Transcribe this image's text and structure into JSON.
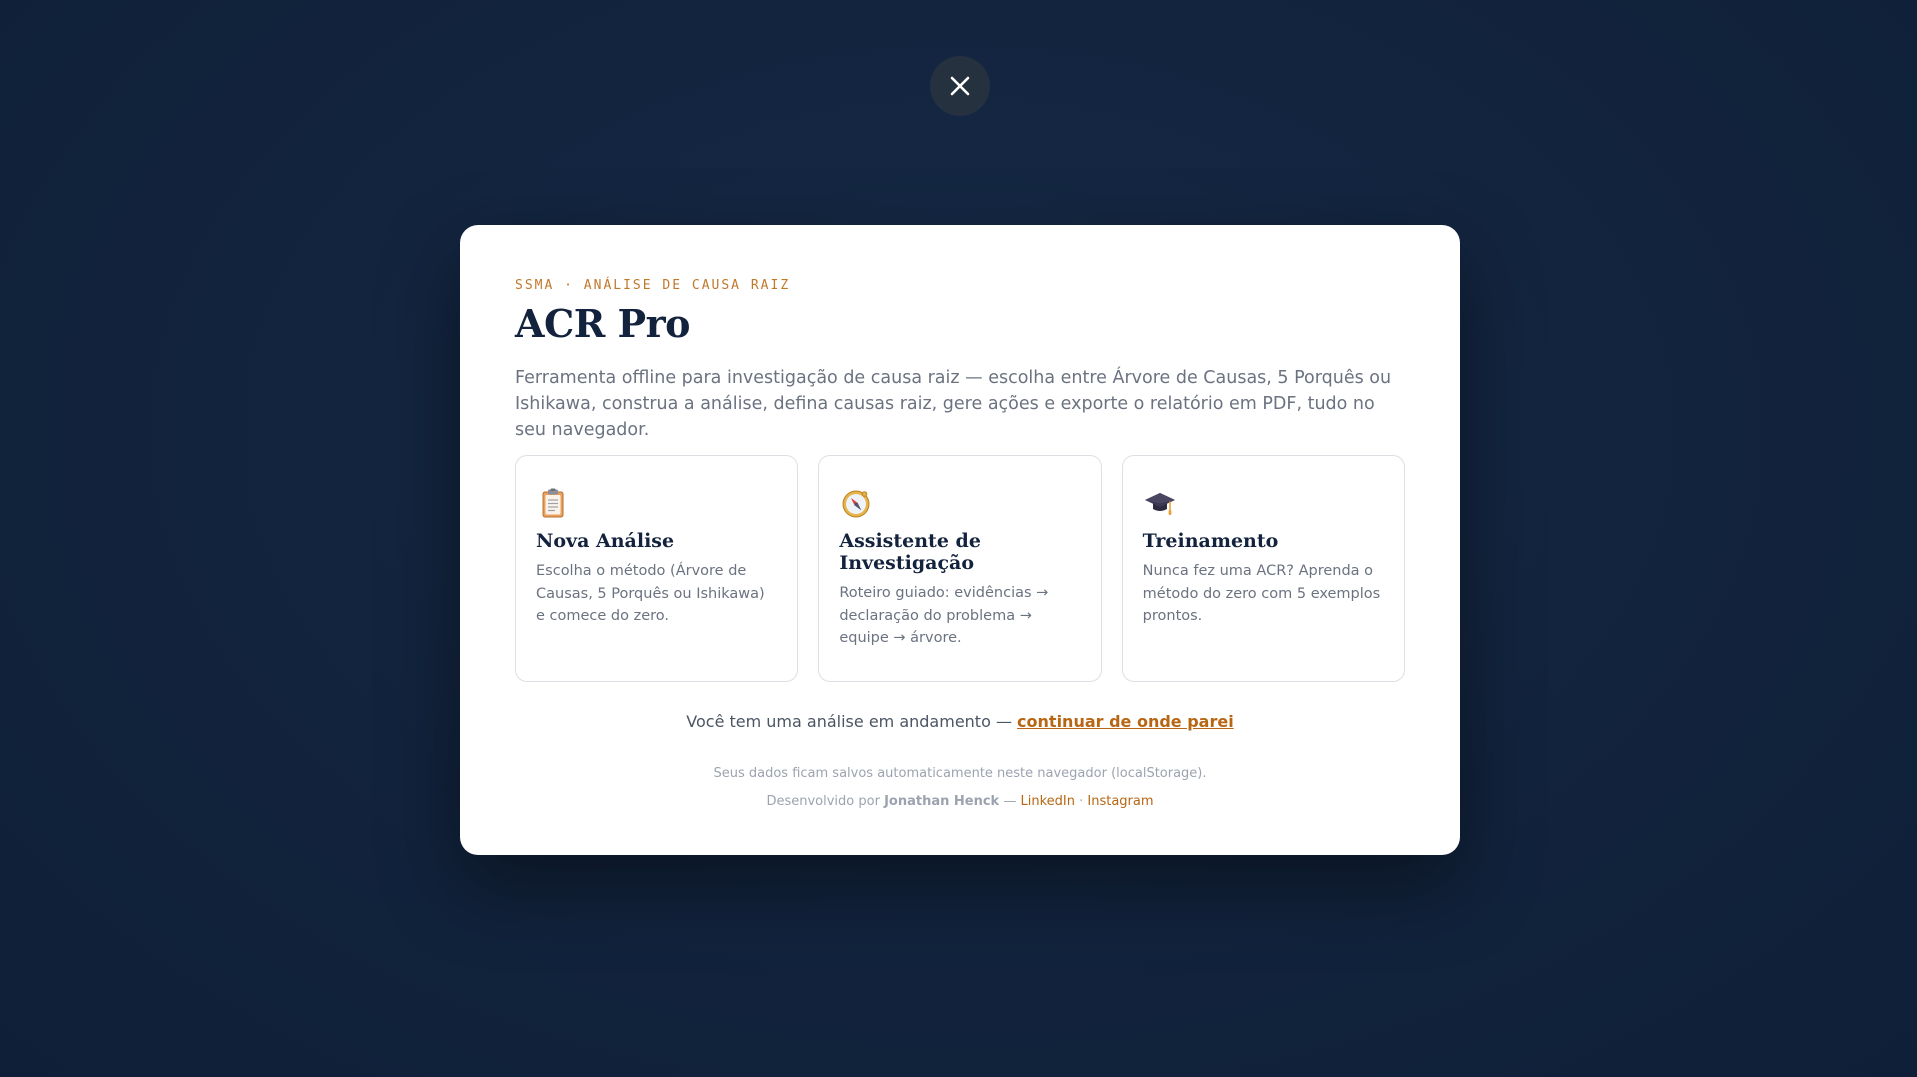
{
  "close_button": {
    "icon": "close-icon",
    "color": "#ffffff"
  },
  "welcome": {
    "eyebrow": "SSMA · ANÁLISE DE CAUSA RAIZ",
    "title": "ACR Pro",
    "description": "Ferramenta offline para investigação de causa raiz — escolha entre Árvore de Causas, 5 Porquês ou Ishikawa, construa a análise, defina causas raiz, gere ações e exporte o relatório em PDF, tudo no seu navegador."
  },
  "cards": [
    {
      "icon": "clipboard-icon",
      "title": "Nova Análise",
      "text": "Escolha o método (Árvore de Causas, 5 Porquês ou Ishikawa) e comece do zero."
    },
    {
      "icon": "compass-icon",
      "title": "Assistente de Investigação",
      "text": "Roteiro guiado: evidências → declaração do problema → equipe → árvore."
    },
    {
      "icon": "graduation-cap-icon",
      "title": "Treinamento",
      "text": "Nunca fez uma ACR? Aprenda o método do zero com 5 exemplos prontos."
    }
  ],
  "resume": {
    "text": "Você tem uma análise em andamento —",
    "link": "continuar de onde parei"
  },
  "footer": {
    "storage_note": "Seus dados ficam salvos automaticamente neste navegador (localStorage).",
    "developed_by": "Desenvolvido por",
    "author": "Jonathan Henck",
    "dash": "—",
    "linkedin": "LinkedIn",
    "separator": "·",
    "instagram": "Instagram"
  },
  "colors": {
    "accent": "#b86614",
    "eyebrow": "#c0782a",
    "heading": "#13233d",
    "muted": "#6b7280",
    "background": "#132540"
  }
}
